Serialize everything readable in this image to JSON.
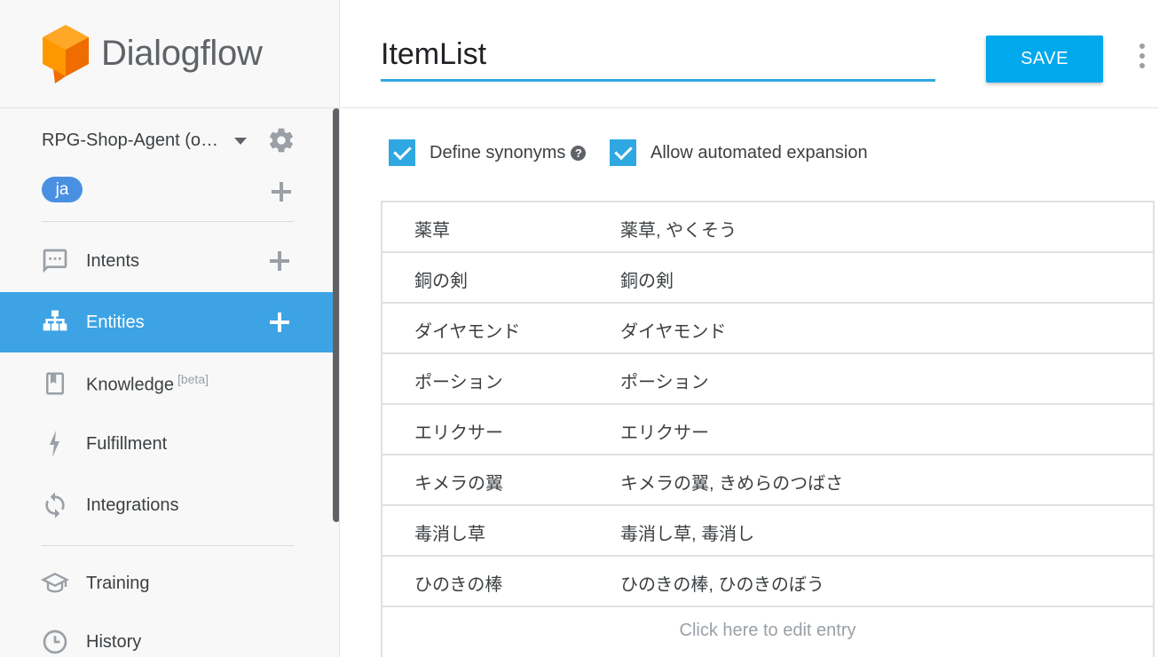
{
  "app": {
    "logo_text": "Dialogflow"
  },
  "sidebar": {
    "agent_name": "RPG-Shop-Agent (o…",
    "language_chip": "ja",
    "items": [
      {
        "label": "Intents",
        "icon": "chat-bubble-icon"
      },
      {
        "label": "Entities",
        "icon": "hierarchy-icon",
        "active": true
      },
      {
        "label": "Knowledge",
        "badge": "[beta]",
        "icon": "book-icon"
      },
      {
        "label": "Fulfillment",
        "icon": "lightning-icon"
      },
      {
        "label": "Integrations",
        "icon": "sync-icon"
      },
      {
        "label": "Training",
        "icon": "graduation-cap-icon"
      },
      {
        "label": "History",
        "icon": "clock-icon"
      }
    ]
  },
  "header": {
    "entity_name": "ItemList",
    "save_label": "SAVE"
  },
  "options": {
    "define_synonyms": {
      "label": "Define synonyms",
      "checked": true
    },
    "automated_expansion": {
      "label": "Allow automated expansion",
      "checked": true
    }
  },
  "entries": [
    {
      "value": "薬草",
      "synonyms": "薬草, やくそう"
    },
    {
      "value": "銅の剣",
      "synonyms": "銅の剣"
    },
    {
      "value": "ダイヤモンド",
      "synonyms": "ダイヤモンド"
    },
    {
      "value": "ポーション",
      "synonyms": "ポーション"
    },
    {
      "value": "エリクサー",
      "synonyms": "エリクサー"
    },
    {
      "value": "キメラの翼",
      "synonyms": "キメラの翼, きめらのつばさ"
    },
    {
      "value": "毒消し草",
      "synonyms": "毒消し草, 毒消し"
    },
    {
      "value": "ひのきの棒",
      "synonyms": "ひのきの棒, ひのきのぼう"
    }
  ],
  "edit_entry_label": "Click here to edit entry",
  "colors": {
    "accent": "#3da3e4",
    "save": "#00a8ec",
    "underline": "#2fa8e2"
  }
}
